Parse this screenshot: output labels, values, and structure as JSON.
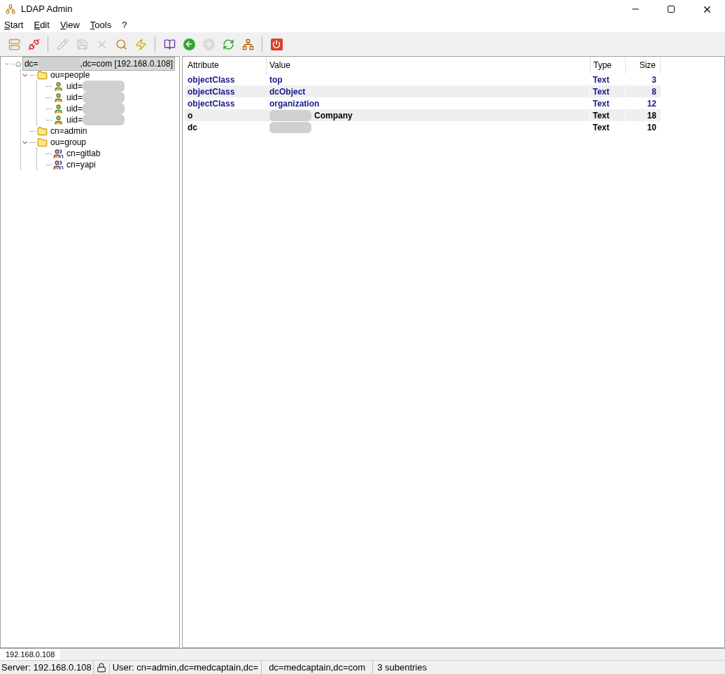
{
  "window": {
    "title": "LDAP Admin"
  },
  "menu": [
    {
      "label": "Start"
    },
    {
      "label": "Edit"
    },
    {
      "label": "View"
    },
    {
      "label": "Tools"
    },
    {
      "label": "?"
    }
  ],
  "toolbar": [
    [
      {
        "disabled": false
      },
      {
        "disabled": false
      }
    ],
    [
      {
        "disabled": true
      },
      {
        "disabled": true
      },
      {
        "disabled": true
      },
      {
        "disabled": false
      },
      {
        "disabled": false
      }
    ],
    [
      {
        "disabled": false
      },
      {
        "disabled": false
      },
      {
        "disabled": true
      },
      {
        "disabled": false
      },
      {
        "disabled": false
      }
    ],
    [
      {
        "disabled": false
      }
    ]
  ],
  "tree": [
    {
      "kind": "server",
      "label": "dc=",
      "label_end": ",dc=com [192.168.0.108]",
      "redacted": true,
      "selected": true,
      "expanded": true,
      "children": [
        {
          "kind": "folder",
          "label": "ou=people",
          "selected": false,
          "expanded": true,
          "children": [
            {
              "kind": "person",
              "label": "uid=",
              "redacted": true,
              "selected": false
            },
            {
              "kind": "person",
              "label": "uid=",
              "redacted": true,
              "selected": false
            },
            {
              "kind": "person",
              "label": "uid=",
              "redacted": true,
              "selected": false
            },
            {
              "kind": "person",
              "label": "uid=",
              "redacted": true,
              "selected": false
            }
          ]
        },
        {
          "kind": "folder",
          "label": "cn=admin",
          "selected": false
        },
        {
          "kind": "folder",
          "label": "ou=group",
          "selected": false,
          "expanded": true,
          "children": [
            {
              "kind": "group",
              "label": "cn=gitlab",
              "selected": false
            },
            {
              "kind": "group",
              "label": "cn=yapi",
              "selected": false
            }
          ]
        }
      ]
    }
  ],
  "table": {
    "columns": [
      "Attribute",
      "Value",
      "Type",
      "Size"
    ],
    "rows": [
      {
        "kind": "objectclass",
        "attribute": "objectClass",
        "value": "top",
        "type": "Text",
        "size": "3"
      },
      {
        "kind": "objectclass",
        "attribute": "objectClass",
        "value": "dcObject",
        "type": "Text",
        "size": "8"
      },
      {
        "kind": "objectclass",
        "attribute": "objectClass",
        "value": "organization",
        "type": "Text",
        "size": "12"
      },
      {
        "kind": "plain",
        "attribute": "o",
        "value": "Company",
        "redacted": true,
        "type": "Text",
        "size": "18"
      },
      {
        "kind": "plain",
        "attribute": "dc",
        "redacted": true,
        "type": "Text",
        "size": "10"
      }
    ]
  },
  "tabs": [
    {
      "label": "192.168.0.108",
      "selected": true
    }
  ],
  "status_bar": {
    "server": "Server: 192.168.0.108",
    "user": "User: cn=admin,dc=medcaptain,dc=",
    "base": "dc=medcaptain,dc=com",
    "count": "3 subentries"
  }
}
